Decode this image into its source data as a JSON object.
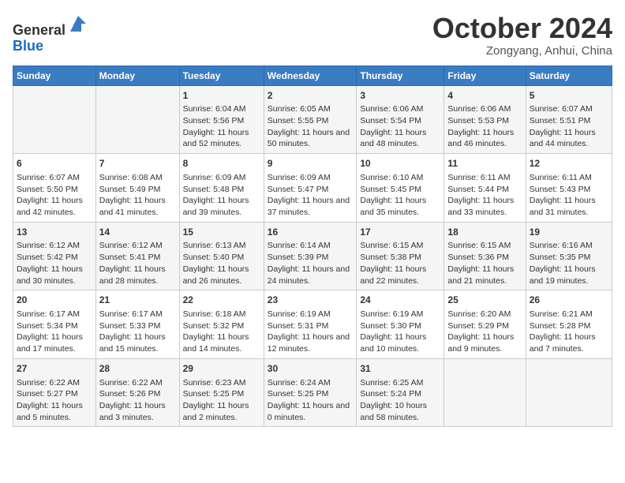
{
  "header": {
    "logo_line1": "General",
    "logo_line2": "Blue",
    "month": "October 2024",
    "location": "Zongyang, Anhui, China"
  },
  "weekdays": [
    "Sunday",
    "Monday",
    "Tuesday",
    "Wednesday",
    "Thursday",
    "Friday",
    "Saturday"
  ],
  "weeks": [
    [
      {
        "day": "",
        "sunrise": "",
        "sunset": "",
        "daylight": ""
      },
      {
        "day": "",
        "sunrise": "",
        "sunset": "",
        "daylight": ""
      },
      {
        "day": "1",
        "sunrise": "Sunrise: 6:04 AM",
        "sunset": "Sunset: 5:56 PM",
        "daylight": "Daylight: 11 hours and 52 minutes."
      },
      {
        "day": "2",
        "sunrise": "Sunrise: 6:05 AM",
        "sunset": "Sunset: 5:55 PM",
        "daylight": "Daylight: 11 hours and 50 minutes."
      },
      {
        "day": "3",
        "sunrise": "Sunrise: 6:06 AM",
        "sunset": "Sunset: 5:54 PM",
        "daylight": "Daylight: 11 hours and 48 minutes."
      },
      {
        "day": "4",
        "sunrise": "Sunrise: 6:06 AM",
        "sunset": "Sunset: 5:53 PM",
        "daylight": "Daylight: 11 hours and 46 minutes."
      },
      {
        "day": "5",
        "sunrise": "Sunrise: 6:07 AM",
        "sunset": "Sunset: 5:51 PM",
        "daylight": "Daylight: 11 hours and 44 minutes."
      }
    ],
    [
      {
        "day": "6",
        "sunrise": "Sunrise: 6:07 AM",
        "sunset": "Sunset: 5:50 PM",
        "daylight": "Daylight: 11 hours and 42 minutes."
      },
      {
        "day": "7",
        "sunrise": "Sunrise: 6:08 AM",
        "sunset": "Sunset: 5:49 PM",
        "daylight": "Daylight: 11 hours and 41 minutes."
      },
      {
        "day": "8",
        "sunrise": "Sunrise: 6:09 AM",
        "sunset": "Sunset: 5:48 PM",
        "daylight": "Daylight: 11 hours and 39 minutes."
      },
      {
        "day": "9",
        "sunrise": "Sunrise: 6:09 AM",
        "sunset": "Sunset: 5:47 PM",
        "daylight": "Daylight: 11 hours and 37 minutes."
      },
      {
        "day": "10",
        "sunrise": "Sunrise: 6:10 AM",
        "sunset": "Sunset: 5:45 PM",
        "daylight": "Daylight: 11 hours and 35 minutes."
      },
      {
        "day": "11",
        "sunrise": "Sunrise: 6:11 AM",
        "sunset": "Sunset: 5:44 PM",
        "daylight": "Daylight: 11 hours and 33 minutes."
      },
      {
        "day": "12",
        "sunrise": "Sunrise: 6:11 AM",
        "sunset": "Sunset: 5:43 PM",
        "daylight": "Daylight: 11 hours and 31 minutes."
      }
    ],
    [
      {
        "day": "13",
        "sunrise": "Sunrise: 6:12 AM",
        "sunset": "Sunset: 5:42 PM",
        "daylight": "Daylight: 11 hours and 30 minutes."
      },
      {
        "day": "14",
        "sunrise": "Sunrise: 6:12 AM",
        "sunset": "Sunset: 5:41 PM",
        "daylight": "Daylight: 11 hours and 28 minutes."
      },
      {
        "day": "15",
        "sunrise": "Sunrise: 6:13 AM",
        "sunset": "Sunset: 5:40 PM",
        "daylight": "Daylight: 11 hours and 26 minutes."
      },
      {
        "day": "16",
        "sunrise": "Sunrise: 6:14 AM",
        "sunset": "Sunset: 5:39 PM",
        "daylight": "Daylight: 11 hours and 24 minutes."
      },
      {
        "day": "17",
        "sunrise": "Sunrise: 6:15 AM",
        "sunset": "Sunset: 5:38 PM",
        "daylight": "Daylight: 11 hours and 22 minutes."
      },
      {
        "day": "18",
        "sunrise": "Sunrise: 6:15 AM",
        "sunset": "Sunset: 5:36 PM",
        "daylight": "Daylight: 11 hours and 21 minutes."
      },
      {
        "day": "19",
        "sunrise": "Sunrise: 6:16 AM",
        "sunset": "Sunset: 5:35 PM",
        "daylight": "Daylight: 11 hours and 19 minutes."
      }
    ],
    [
      {
        "day": "20",
        "sunrise": "Sunrise: 6:17 AM",
        "sunset": "Sunset: 5:34 PM",
        "daylight": "Daylight: 11 hours and 17 minutes."
      },
      {
        "day": "21",
        "sunrise": "Sunrise: 6:17 AM",
        "sunset": "Sunset: 5:33 PM",
        "daylight": "Daylight: 11 hours and 15 minutes."
      },
      {
        "day": "22",
        "sunrise": "Sunrise: 6:18 AM",
        "sunset": "Sunset: 5:32 PM",
        "daylight": "Daylight: 11 hours and 14 minutes."
      },
      {
        "day": "23",
        "sunrise": "Sunrise: 6:19 AM",
        "sunset": "Sunset: 5:31 PM",
        "daylight": "Daylight: 11 hours and 12 minutes."
      },
      {
        "day": "24",
        "sunrise": "Sunrise: 6:19 AM",
        "sunset": "Sunset: 5:30 PM",
        "daylight": "Daylight: 11 hours and 10 minutes."
      },
      {
        "day": "25",
        "sunrise": "Sunrise: 6:20 AM",
        "sunset": "Sunset: 5:29 PM",
        "daylight": "Daylight: 11 hours and 9 minutes."
      },
      {
        "day": "26",
        "sunrise": "Sunrise: 6:21 AM",
        "sunset": "Sunset: 5:28 PM",
        "daylight": "Daylight: 11 hours and 7 minutes."
      }
    ],
    [
      {
        "day": "27",
        "sunrise": "Sunrise: 6:22 AM",
        "sunset": "Sunset: 5:27 PM",
        "daylight": "Daylight: 11 hours and 5 minutes."
      },
      {
        "day": "28",
        "sunrise": "Sunrise: 6:22 AM",
        "sunset": "Sunset: 5:26 PM",
        "daylight": "Daylight: 11 hours and 3 minutes."
      },
      {
        "day": "29",
        "sunrise": "Sunrise: 6:23 AM",
        "sunset": "Sunset: 5:25 PM",
        "daylight": "Daylight: 11 hours and 2 minutes."
      },
      {
        "day": "30",
        "sunrise": "Sunrise: 6:24 AM",
        "sunset": "Sunset: 5:25 PM",
        "daylight": "Daylight: 11 hours and 0 minutes."
      },
      {
        "day": "31",
        "sunrise": "Sunrise: 6:25 AM",
        "sunset": "Sunset: 5:24 PM",
        "daylight": "Daylight: 10 hours and 58 minutes."
      },
      {
        "day": "",
        "sunrise": "",
        "sunset": "",
        "daylight": ""
      },
      {
        "day": "",
        "sunrise": "",
        "sunset": "",
        "daylight": ""
      }
    ]
  ]
}
